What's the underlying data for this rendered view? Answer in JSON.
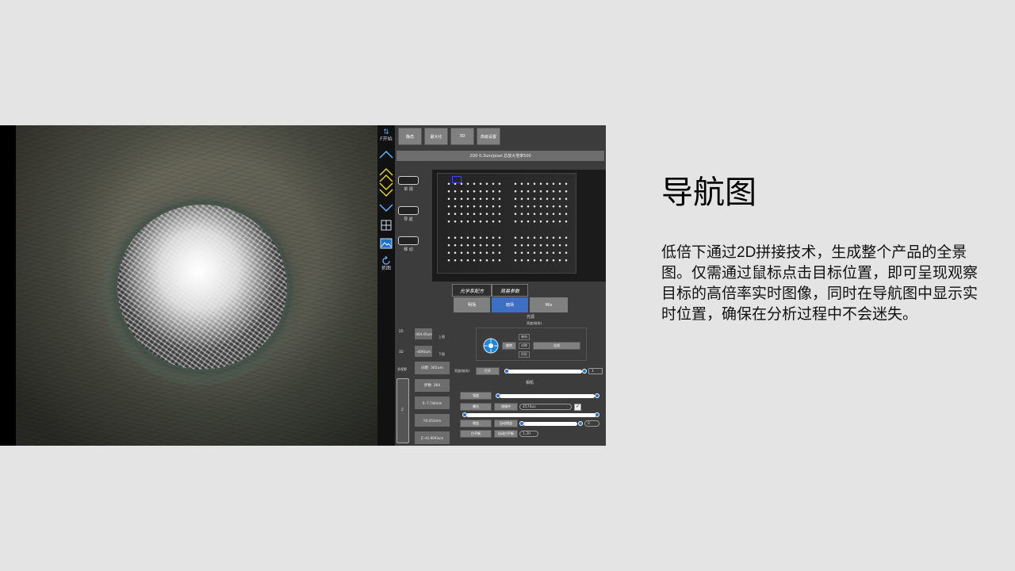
{
  "slide": {
    "title": "导航图",
    "description": "低倍下通过2D拼接技术，生成整个产品的全景图。仅需通过鼠标点击目标位置，即可呈现观察目标的高倍率实时图像，同时在导航图中显示实时位置，确保在分析过程中不会迷失。"
  },
  "app": {
    "toolbar": {
      "top_label": "F开始",
      "bottom_label": "抓图"
    },
    "top_buttons": [
      "静态",
      "最大化",
      "3D",
      "高级设置"
    ],
    "info_bar": "2D0 0.3um/pixel 总放大倍率500",
    "nav_side": {
      "items": [
        "单 视",
        "导 航",
        "移 动"
      ]
    },
    "left_panel": {
      "labels": {
        "twoD": "2D",
        "threeD": "3D",
        "upper": "上限",
        "lower": "下限",
        "multi": "多视野"
      },
      "fields": [
        "-404.45um",
        "-4093um",
        "间距: 365um",
        "步数: 364",
        "X:-7.744mm",
        "Y:6.451mm",
        "Z:-41.9093um"
      ],
      "slider_label": "Z"
    },
    "tabs": {
      "optical": "光学系配方",
      "simple": "简易参数"
    },
    "modes": [
      "明场",
      "暗场",
      "Mix"
    ],
    "light": {
      "heading": "光源",
      "subheading": "亮度(暗场)",
      "options": [
        "单向",
        "对称",
        "环形"
      ],
      "buttons": [
        "旋转",
        "全部"
      ],
      "row_label": "亮度(暗场)",
      "row_button": "打开",
      "row_value": "1"
    },
    "camera": {
      "heading": "相机",
      "rows": [
        {
          "label": "强度"
        },
        {
          "label": "曝光",
          "button": "透镜中",
          "value": "4574us"
        },
        {
          "label": "增益",
          "button": "自动增益",
          "value": "0"
        },
        {
          "label": "白平衡",
          "button": "自动白平衡",
          "value": "1.20"
        }
      ]
    }
  },
  "colors": {
    "slide_bg": "#e4e4e4",
    "accent_blue": "#1d6fd0",
    "active_tab": "#3e6fc4"
  }
}
